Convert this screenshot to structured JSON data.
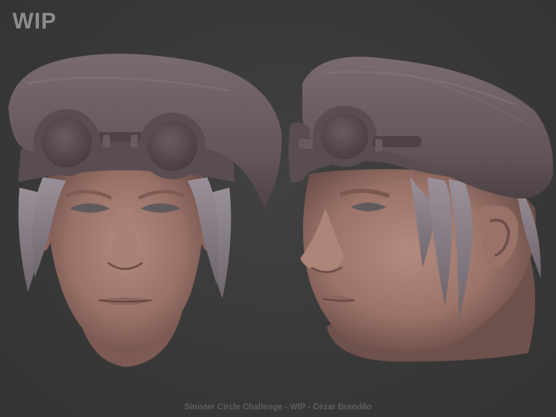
{
  "overlay": {
    "title": "WIP",
    "caption": "Sinister Circle Challenge - WIP - Cézar Brandão"
  },
  "scene": {
    "background": "#3a3a3a",
    "skin_color": "#a07a70",
    "hat_color": "#6b5c60",
    "hair_color": "#8a7f86",
    "goggle_color": "#5d5055",
    "views": [
      "front-view",
      "three-quarter-view"
    ]
  }
}
